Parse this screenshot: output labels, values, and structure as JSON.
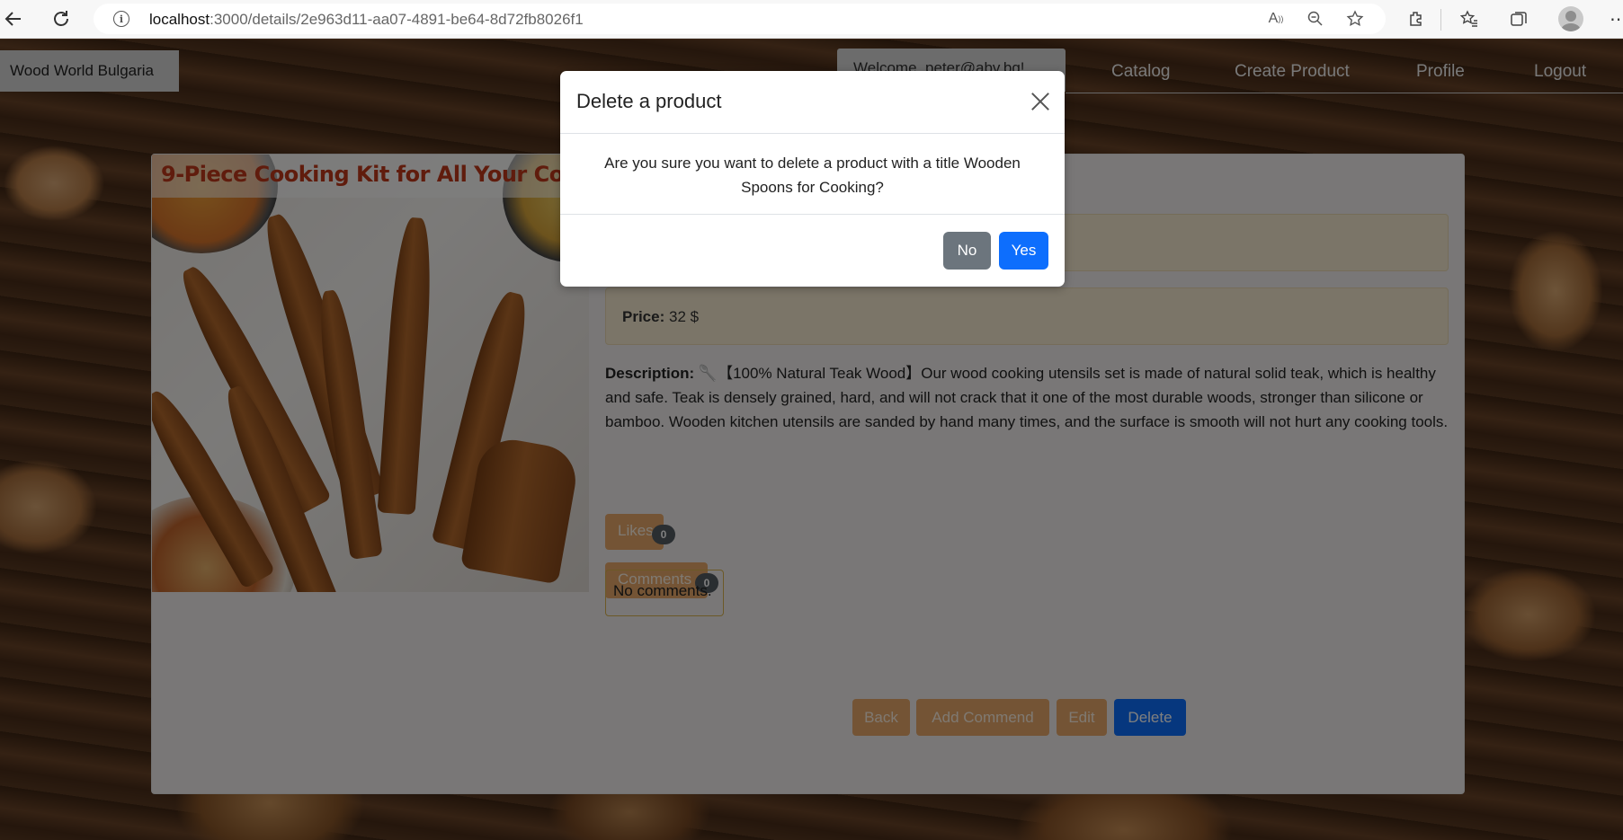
{
  "browser": {
    "url_host": "localhost",
    "url_path": ":3000/details/2e963d11-aa07-4891-be64-8d72fb8026f1"
  },
  "nav": {
    "brand": "Wood World Bulgaria",
    "welcome": "Welcome, peter@abv.bg!",
    "links": [
      "Catalog",
      "Create Product",
      "Profile",
      "Logout"
    ]
  },
  "product": {
    "image_title": "9-Piece Cooking Kit for All Your Cooking Needs",
    "price_label": "Price:",
    "price_value": "32 $",
    "description_label": "Description:",
    "description_text": "🥄【100% Natural Teak Wood】Our wood cooking utensils set is made of natural solid teak, which is healthy and safe. Teak is densely grained, hard, and will not crack that it one of the most durable woods, stronger than silicone or bamboo. Wooden kitchen utensils are sanded by hand many times, and the surface is smooth will not hurt any cooking tools.",
    "likes_label": "Likes",
    "likes_count": "0",
    "comments_label": "Comments",
    "comments_count": "0",
    "no_comments": "No comments."
  },
  "actions": {
    "back": "Back",
    "add_comment": "Add Commend",
    "edit": "Edit",
    "delete": "Delete"
  },
  "modal": {
    "title": "Delete a product",
    "message": "Are you sure you want to delete a product with a title Wooden Spoons for Cooking?",
    "no": "No",
    "yes": "Yes"
  },
  "colors": {
    "primary": "#0d6efd",
    "secondary": "#6c757d",
    "accent": "#e8a96a"
  }
}
